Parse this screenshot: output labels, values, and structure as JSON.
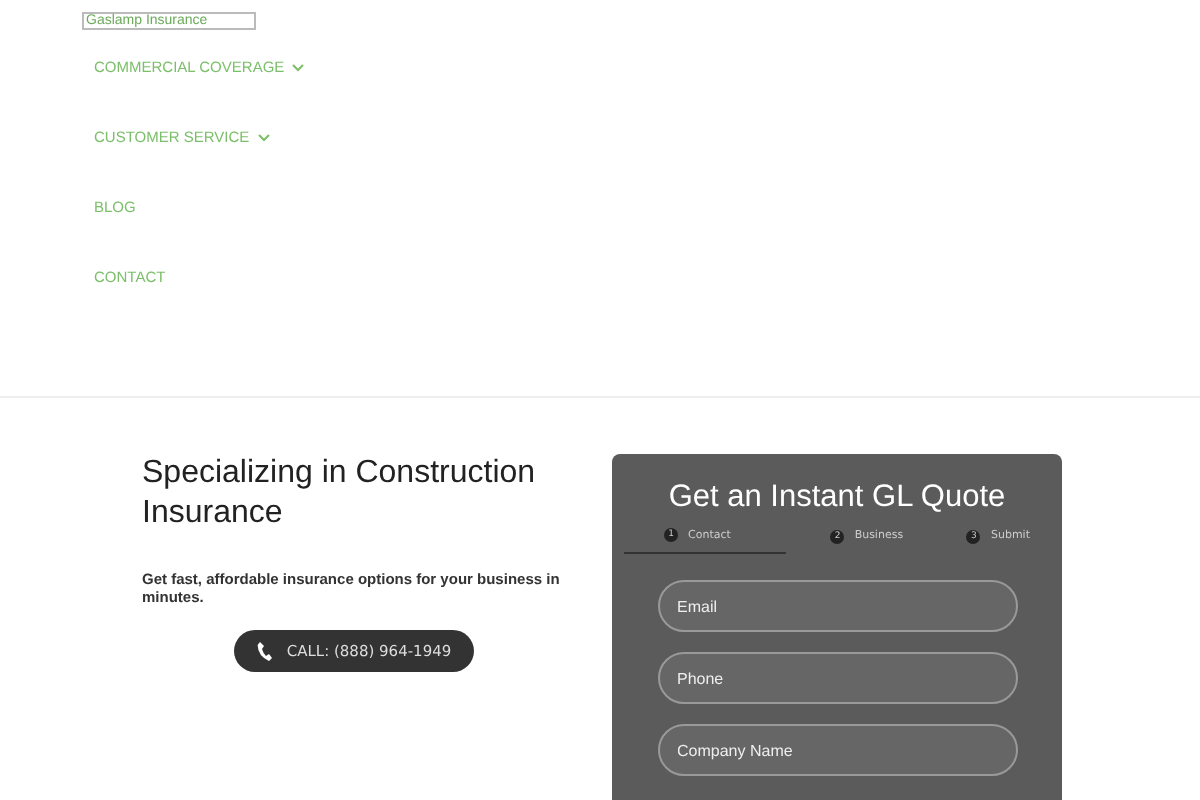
{
  "logo": {
    "text": "Gaslamp Insurance"
  },
  "nav": [
    {
      "label": "COMMERCIAL COVERAGE",
      "has_submenu": true
    },
    {
      "label": "CUSTOMER SERVICE",
      "has_submenu": true
    },
    {
      "label": "BLOG",
      "has_submenu": false
    },
    {
      "label": "CONTACT",
      "has_submenu": false
    }
  ],
  "hero": {
    "heading": "Specializing in Construction Insurance",
    "text": "Get fast, affordable insurance options for your business in minutes.",
    "call_button": "CALL: (888) 964-1949"
  },
  "quote_form": {
    "title": "Get an Instant GL Quote",
    "steps": [
      {
        "number": "1",
        "label": "Contact",
        "selected": true
      },
      {
        "number": "2",
        "label": "Business",
        "selected": false
      },
      {
        "number": "3",
        "label": "Submit",
        "selected": false
      }
    ],
    "fields": [
      {
        "placeholder": "Email"
      },
      {
        "placeholder": "Phone"
      },
      {
        "placeholder": "Company Name"
      }
    ]
  }
}
